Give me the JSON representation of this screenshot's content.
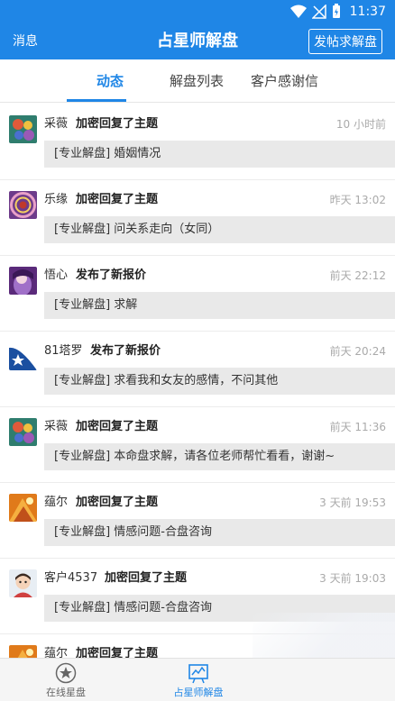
{
  "status_bar": {
    "time": "11:37",
    "icons": [
      "wifi-icon",
      "signal-icon",
      "battery-icon"
    ]
  },
  "app_bar": {
    "left_label": "消息",
    "title": "占星师解盘",
    "right_button": "发帖求解盘"
  },
  "tabs": [
    {
      "label": "动态",
      "active": true
    },
    {
      "label": "解盘列表",
      "active": false
    },
    {
      "label": "客户感谢信",
      "active": false
    }
  ],
  "feed": [
    {
      "user": "采薇",
      "action": "加密回复了主题",
      "time": "10 小时前",
      "post": "[专业解盘] 婚姻情况",
      "avatar": "avatar-caiwei"
    },
    {
      "user": "乐缘",
      "action": "加密回复了主题",
      "time": "昨天 13:02",
      "post": "[专业解盘] 问关系走向（女同）",
      "avatar": "avatar-leyuan"
    },
    {
      "user": "悟心",
      "action": "发布了新报价",
      "time": "前天 22:12",
      "post": "[专业解盘] 求解",
      "avatar": "avatar-wuxin"
    },
    {
      "user": "81塔罗",
      "action": "发布了新报价",
      "time": "前天 20:24",
      "post": "[专业解盘] 求看我和女友的感情，不问其他",
      "avatar": "avatar-81taluo"
    },
    {
      "user": "采薇",
      "action": "加密回复了主题",
      "time": "前天 11:36",
      "post": "[专业解盘] 本命盘求解，请各位老师帮忙看看，谢谢~",
      "avatar": "avatar-caiwei"
    },
    {
      "user": "蕴尔",
      "action": "加密回复了主题",
      "time": "3 天前 19:53",
      "post": "[专业解盘] 情感问题-合盘咨询",
      "avatar": "avatar-yuner"
    },
    {
      "user": "客户4537",
      "action": "加密回复了主题",
      "time": "3 天前 19:03",
      "post": "[专业解盘] 情感问题-合盘咨询",
      "avatar": "avatar-kehu"
    },
    {
      "user": "蕴尔",
      "action": "加密回复了主题",
      "time": "",
      "post": "",
      "avatar": "avatar-yuner"
    }
  ],
  "bottom_nav": [
    {
      "label": "在线星盘",
      "icon": "star-circle-icon",
      "active": false
    },
    {
      "label": "占星师解盘",
      "icon": "chart-board-icon",
      "active": true
    }
  ],
  "colors": {
    "primary": "#1f86e6",
    "post_bg": "#e9e9e9",
    "timestamp": "#aaaaaa"
  }
}
